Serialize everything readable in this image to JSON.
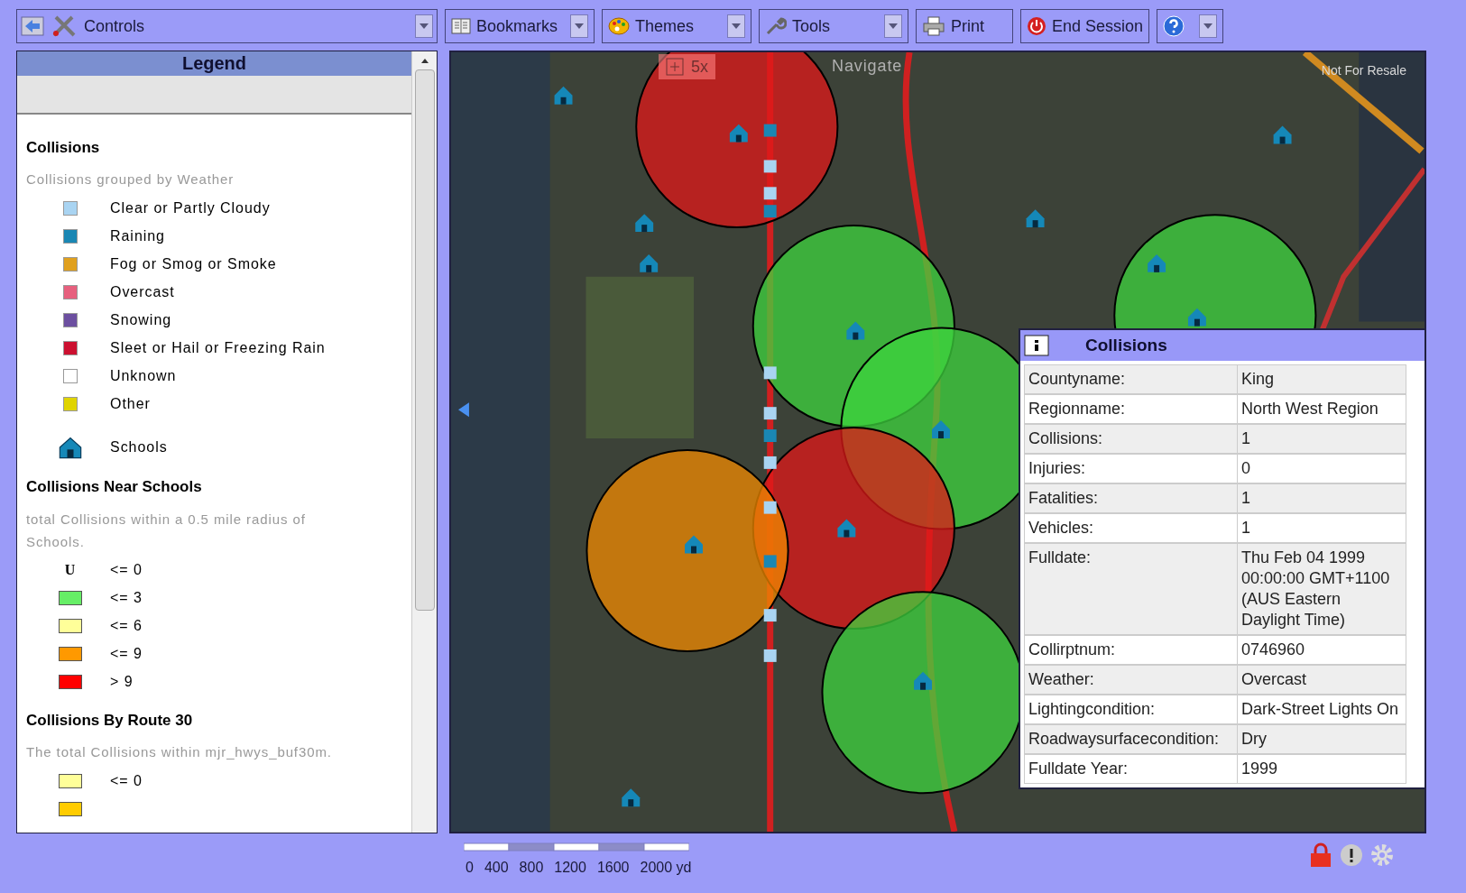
{
  "toolbar": {
    "controls": {
      "label": "Controls"
    },
    "menus": [
      {
        "kind": "bookmarks",
        "label": "Bookmarks"
      },
      {
        "kind": "themes",
        "label": "Themes"
      },
      {
        "kind": "tools",
        "label": "Tools"
      },
      {
        "kind": "print",
        "label": "Print"
      },
      {
        "kind": "end",
        "label": "End Session"
      },
      {
        "kind": "help"
      }
    ]
  },
  "legend": {
    "title": "Legend",
    "sections": [
      {
        "title": "Collisions",
        "description": "Collisions grouped by Weather",
        "items": [
          {
            "kind": "swatch",
            "color": "#a9d4f2",
            "label": "Clear or Partly Cloudy"
          },
          {
            "kind": "swatch",
            "color": "#1a87b4",
            "label": "Raining"
          },
          {
            "kind": "swatch",
            "color": "#e0a01e",
            "label": "Fog or Smog or Smoke"
          },
          {
            "kind": "swatch",
            "color": "#e7607e",
            "label": "Overcast"
          },
          {
            "kind": "swatch",
            "color": "#6c4fa0",
            "label": "Snowing"
          },
          {
            "kind": "swatch",
            "color": "#cc1030",
            "label": "Sleet or Hail or Freezing Rain"
          },
          {
            "kind": "swatch",
            "color": "#ffffff",
            "label": "Unknown"
          },
          {
            "kind": "swatch",
            "color": "#e0d400",
            "label": "Other"
          },
          {
            "kind": "school",
            "label": "Schools"
          }
        ]
      },
      {
        "title": "Collisions Near Schools",
        "description": "total Collisions within a 0.5 mile radius of Schools.",
        "items": [
          {
            "kind": "symbol",
            "symbol": "U",
            "label": "<= 0"
          },
          {
            "kind": "wide",
            "color": "#66ee66",
            "label": "<= 3"
          },
          {
            "kind": "wide",
            "color": "#ffff99",
            "label": "<= 6"
          },
          {
            "kind": "wide",
            "color": "#ff9900",
            "label": "<= 9"
          },
          {
            "kind": "wide",
            "color": "#ff0000",
            "label": "> 9"
          }
        ]
      },
      {
        "title": "Collisions By Route 30",
        "description": "The total Collisions within mjr_hwys_buf30m.",
        "items": [
          {
            "kind": "wide",
            "color": "#ffff99",
            "label": "<= 0"
          },
          {
            "kind": "wide",
            "color": "#ffcc00"
          }
        ]
      }
    ]
  },
  "map": {
    "zoom": {
      "label": "5x"
    },
    "navigate": {
      "label": "Navigate"
    },
    "license_note": "Not For Resale"
  },
  "popup": {
    "title": "Collisions",
    "rows": [
      {
        "label": "Countyname:",
        "value": "King"
      },
      {
        "label": "Regionname:",
        "value": "North West Region"
      },
      {
        "label": "Collisions:",
        "value": "1"
      },
      {
        "label": "Injuries:",
        "value": "0"
      },
      {
        "label": "Fatalities:",
        "value": "1"
      },
      {
        "label": "Vehicles:",
        "value": "1"
      },
      {
        "label": "Fulldate:",
        "value": "Thu Feb 04 1999 00:00:00 GMT+1100 (AUS Eastern Daylight Time)"
      },
      {
        "label": "Collirptnum:",
        "value": "0746960"
      },
      {
        "label": "Weather:",
        "value": "Overcast"
      },
      {
        "label": "Lightingcondition:",
        "value": "Dark-Street Lights On"
      },
      {
        "label": "Roadwaysurfacecondition:",
        "value": "Dry"
      },
      {
        "label": "Fulldate Year:",
        "value": "1999"
      }
    ]
  },
  "scale": {
    "ticks": [
      "0",
      "400",
      "800",
      "1200",
      "1600",
      "2000 yd"
    ]
  }
}
